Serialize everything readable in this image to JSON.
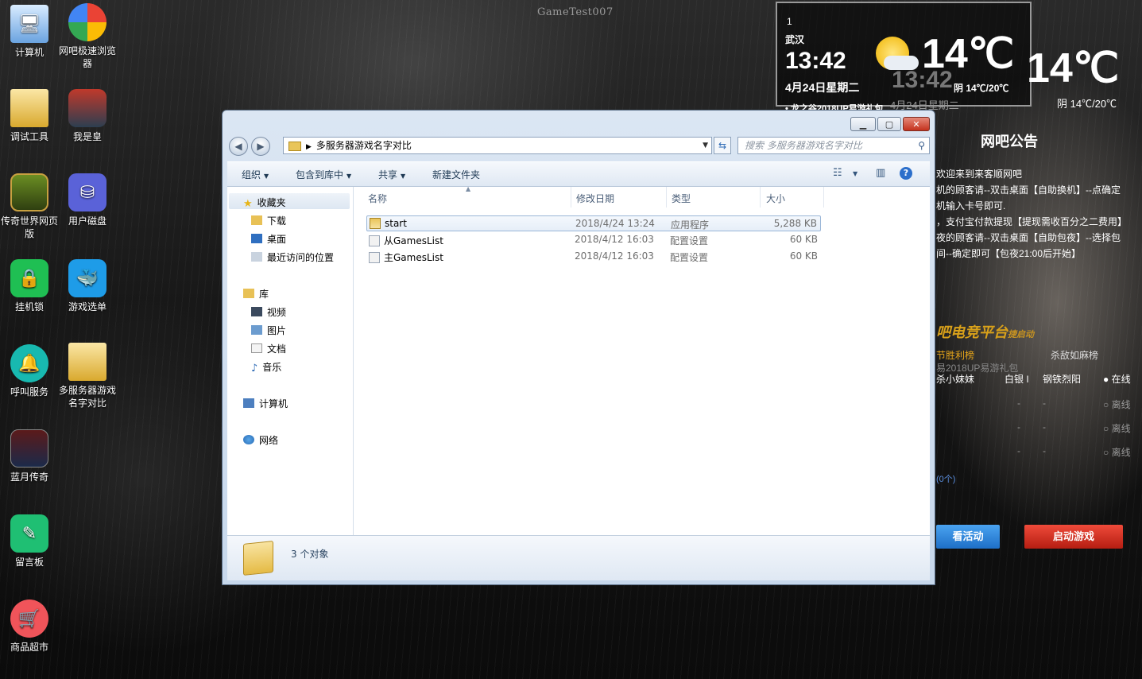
{
  "desktop": {
    "watermark": "GameTest007",
    "icons": [
      {
        "label": "计算机"
      },
      {
        "label": "网吧极速浏览器"
      },
      {
        "label": "调试工具"
      },
      {
        "label": "我是皇"
      },
      {
        "label": "传奇世界网页版"
      },
      {
        "label": "用户磁盘"
      },
      {
        "label": "挂机锁"
      },
      {
        "label": "游戏选单"
      },
      {
        "label": "呼叫服务"
      },
      {
        "label": "多服务器游戏名字对比"
      },
      {
        "label": "蓝月传奇"
      },
      {
        "label": "留言板"
      },
      {
        "label": "商品超市"
      }
    ]
  },
  "weather": {
    "index": "1",
    "city": "武汉",
    "time": "13:42",
    "date": "4月24日星期二",
    "temp": "14℃",
    "condition": "阴 14℃/20℃",
    "news": "• 龙之谷2018UP易游礼包",
    "ghost_time": "13:42",
    "ghost_date": "4月24日星期二",
    "temp2": "14℃",
    "condition2": "阴 14℃/20℃"
  },
  "panel": {
    "title": "网吧公告",
    "lines": [
      "欢迎来到来客顺网吧",
      "机的顾客请--双击桌面【自助换机】--点确定",
      "机输入卡号即可.",
      "，支付宝付款提现【提现需收百分之二费用】",
      "夜的顾客请--双击桌面【自助包夜】--选择包",
      "间--确定即可【包夜21:00后开始】"
    ],
    "brand": "吧电竞平台",
    "brand_sub": "捷启动",
    "tab1": "节胜利榜",
    "tab2": "杀敌如麻榜",
    "gift": "易2018UP易游礼包",
    "rows": [
      {
        "a": "杀小妹妹",
        "b": "白银 I",
        "c": "钢铁烈阳",
        "d": "● 在线"
      },
      {
        "a": "",
        "b": "-",
        "c": "-",
        "d": "○ 离线"
      },
      {
        "a": "",
        "b": "-",
        "c": "-",
        "d": "○ 离线"
      },
      {
        "a": "",
        "b": "-",
        "c": "-",
        "d": "○ 离线"
      }
    ],
    "count": "(0个)",
    "activity_button": "看活动",
    "start_button": "启动游戏"
  },
  "explorer": {
    "path": "多服务器游戏名字对比",
    "search_placeholder": "搜索 多服务器游戏名字对比",
    "toolbar": {
      "organize": "组织",
      "include": "包含到库中",
      "share": "共享",
      "new_folder": "新建文件夹"
    },
    "nav": {
      "favorites": "收藏夹",
      "downloads": "下载",
      "desktop": "桌面",
      "recent": "最近访问的位置",
      "libraries": "库",
      "videos": "视频",
      "pictures": "图片",
      "documents": "文档",
      "music": "音乐",
      "computer": "计算机",
      "network": "网络"
    },
    "columns": {
      "name": "名称",
      "date": "修改日期",
      "type": "类型",
      "size": "大小"
    },
    "files": [
      {
        "name": "start",
        "date": "2018/4/24 13:24",
        "type": "应用程序",
        "size": "5,288 KB"
      },
      {
        "name": "从GamesList",
        "date": "2018/4/12 16:03",
        "type": "配置设置",
        "size": "60 KB"
      },
      {
        "name": "主GamesList",
        "date": "2018/4/12 16:03",
        "type": "配置设置",
        "size": "60 KB"
      }
    ],
    "status": "3 个对象"
  }
}
